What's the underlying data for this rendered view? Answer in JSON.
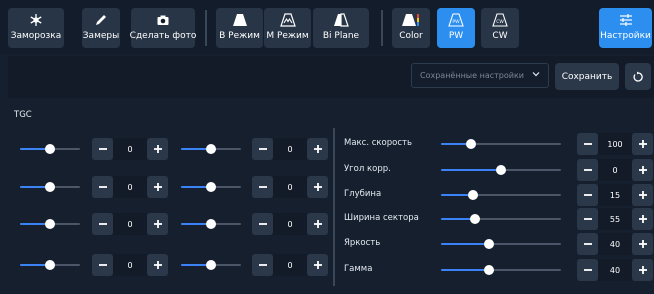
{
  "toolbar": {
    "buttons": [
      {
        "label": "Заморозка",
        "icon": "snowflake-icon"
      },
      {
        "label": "Замеры",
        "icon": "pencil-icon"
      },
      {
        "label": "Сделать фото",
        "icon": "camera-icon"
      },
      {
        "label": "B Режим",
        "icon": "b-mode-icon"
      },
      {
        "label": "M Режим",
        "icon": "m-mode-icon"
      },
      {
        "label": "Bi Plane",
        "icon": "bi-plane-icon"
      },
      {
        "label": "Color",
        "icon": "color-mode-icon"
      },
      {
        "label": "PW",
        "icon": "pw-mode-icon"
      },
      {
        "label": "CW",
        "icon": "cw-mode-icon"
      },
      {
        "label": "Настройки",
        "icon": "sliders-icon"
      }
    ],
    "active": [
      "PW",
      "Настройки"
    ]
  },
  "presets": {
    "placeholder": "Сохранённые настройки",
    "save_label": "Сохранить"
  },
  "tgc": {
    "title": "TGC",
    "left": [
      {
        "level": 0.5,
        "value": "0"
      },
      {
        "level": 0.5,
        "value": "0"
      },
      {
        "level": 0.5,
        "value": "0"
      },
      {
        "level": 0.5,
        "value": "0"
      }
    ],
    "right": [
      {
        "level": 0.5,
        "value": "0"
      },
      {
        "level": 0.5,
        "value": "0"
      },
      {
        "level": 0.5,
        "value": "0"
      },
      {
        "level": 0.5,
        "value": "0"
      }
    ]
  },
  "params": [
    {
      "label": "Макс. скорость",
      "level": 0.25,
      "value": "100"
    },
    {
      "label": "Угол корр.",
      "level": 0.5,
      "value": "0"
    },
    {
      "label": "Глубина",
      "level": 0.27,
      "value": "15"
    },
    {
      "label": "Ширина сектора",
      "level": 0.28,
      "value": "55"
    },
    {
      "label": "Яркость",
      "level": 0.4,
      "value": "40"
    },
    {
      "label": "Гамма",
      "level": 0.4,
      "value": "40"
    }
  ],
  "colors": {
    "accent": "#2c8ff0",
    "slider_fill": "#3b82f6",
    "background": "#151f2e"
  }
}
